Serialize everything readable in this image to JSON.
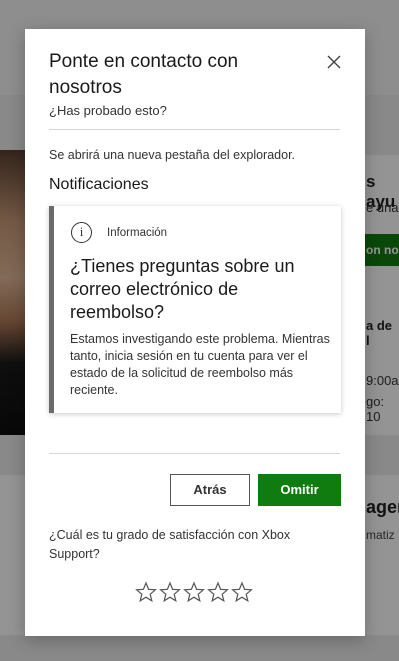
{
  "background": {
    "right_heading": "s ayu",
    "right_text": "e una",
    "right_button": "on no",
    "right_line1": "a de l",
    "right_line2": "9:00an",
    "right_line3": "go: 10",
    "lower_heading": "ager",
    "lower_text": "matiz"
  },
  "dialog": {
    "title": "Ponte en contacto con nosotros",
    "subtitle": "¿Has probado esto?",
    "new_tab_note": "Se abrirá una nueva pestaña del explorador.",
    "section_heading": "Notificaciones",
    "info_card": {
      "label": "Información",
      "question": "¿Tienes preguntas sobre un correo electrónico de reembolso?",
      "body": "Estamos investigando este problema. Mientras tanto, inicia sesión en tu cuenta para ver el estado de la solicitud de reembolso más reciente."
    },
    "back_label": "Atrás",
    "skip_label": "Omitir",
    "satisfaction_question": "¿Cuál es tu grado de satisfacción con Xbox Support?",
    "rating": {
      "max": 5,
      "selected": 0
    }
  },
  "colors": {
    "accent": "#107c10",
    "overlay": "rgba(0,0,0,0.42)",
    "card_border": "#6b6b6b"
  },
  "icons": [
    "close-icon",
    "info-icon",
    "star-icon"
  ]
}
